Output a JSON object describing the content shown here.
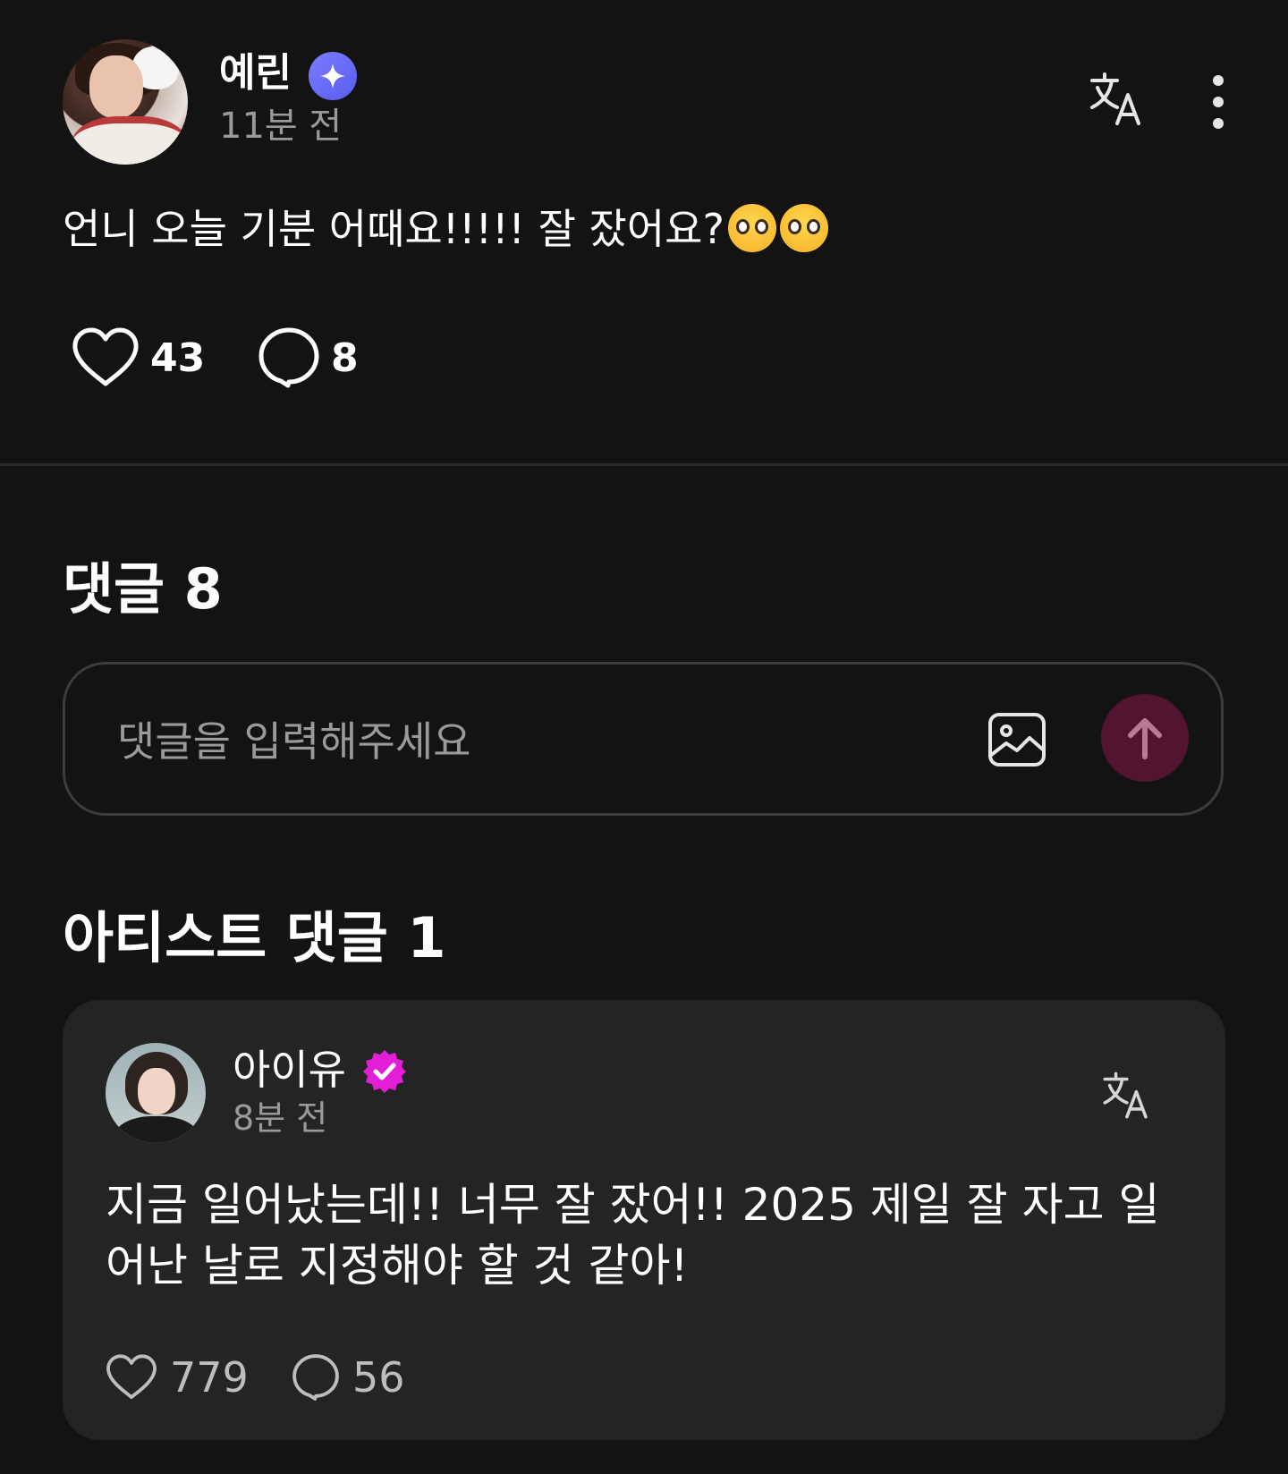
{
  "post": {
    "author_name": "예린",
    "badge_icon": "sparkle-badge-icon",
    "time": "11분 전",
    "body_text": "언니 오늘 기분 어때요!!!!! 잘 잤어요?",
    "emojis": [
      "pleading-face-emoji",
      "pleading-face-emoji"
    ],
    "likes": "43",
    "comments": "8"
  },
  "comments_section": {
    "title": "댓글 8",
    "input_placeholder": "댓글을 입력해주세요"
  },
  "artist_section": {
    "title": "아티스트 댓글 1",
    "comment": {
      "author_name": "아이유",
      "time": "8분 전",
      "body_text": "지금 일어났는데!! 너무 잘 잤어!! 2025 제일 잘 자고 일어난 날로 지정해야 할 것 같아!",
      "likes": "779",
      "comments": "56"
    }
  },
  "colors": {
    "background": "#131313",
    "card_background": "#242424",
    "send_button": "#52142f",
    "star_badge": "#6b6ef5",
    "check_badge": "#e21ed6",
    "muted_text": "#9a9a9a"
  }
}
